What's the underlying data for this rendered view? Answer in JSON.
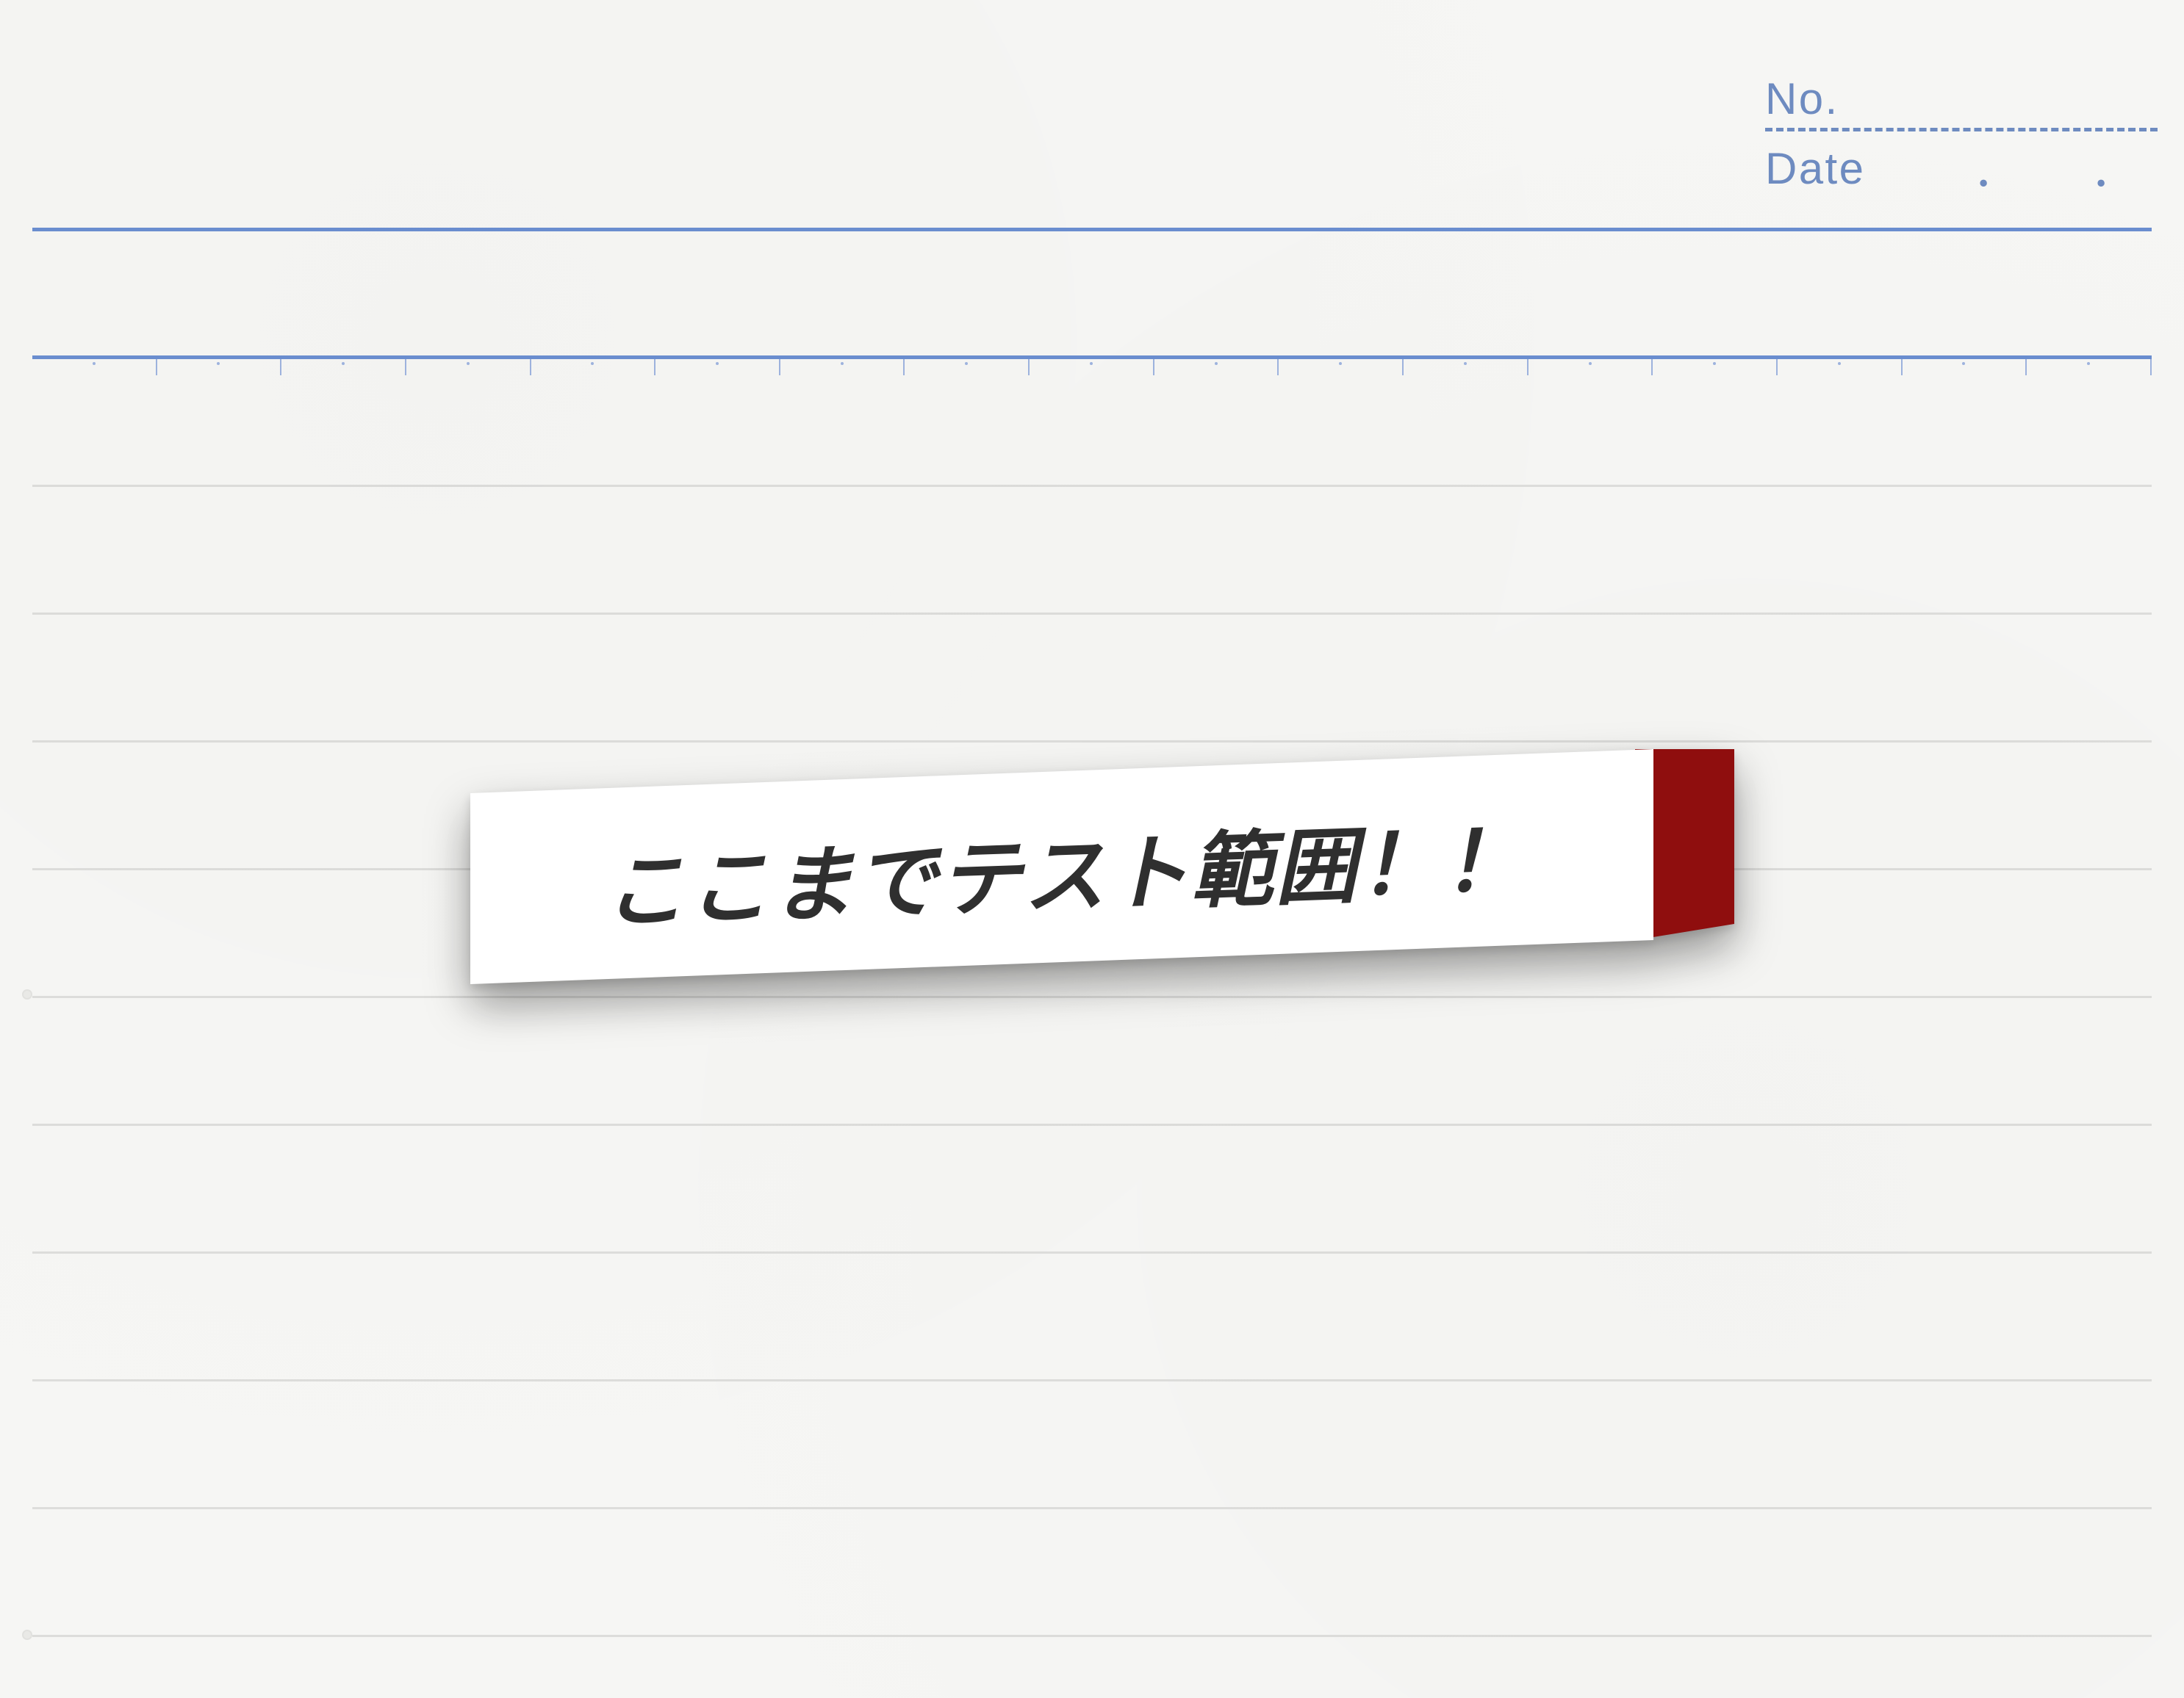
{
  "header": {
    "no_label": "No.",
    "date_label": "Date",
    "date_dot": "・"
  },
  "sticky": {
    "text": "ここまでテスト範囲！！",
    "tab_color": "#8f0e0e",
    "paper_color": "#ffffff"
  },
  "colors": {
    "rule_blue": "#6a8dcf",
    "rule_gray": "rgba(0,0,0,.10)"
  },
  "layout": {
    "gray_rule_tops": [
      660,
      834,
      1008,
      1182,
      1356,
      1530,
      1704,
      1878,
      2052,
      2226
    ],
    "punch_tops": [
      1354,
      2226
    ],
    "tick_count": 17
  }
}
